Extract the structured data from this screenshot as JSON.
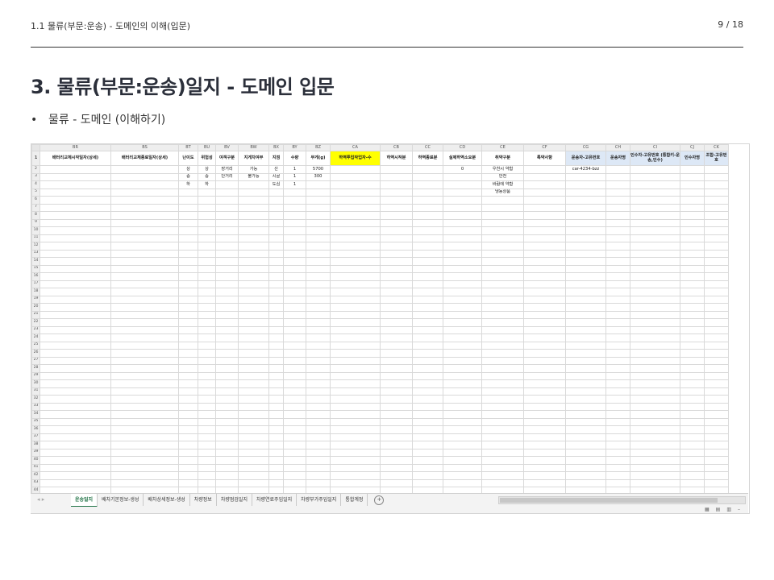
{
  "header": {
    "breadcrumb": "1.1 물류(부문:운송) - 도메인의 이해(입문)",
    "page_num": "9 / 18"
  },
  "title": "3. 물류(부문:운송)일지 - 도메인 입문",
  "bullet": "물류 - 도메인 (이해하기)",
  "sheet": {
    "columns": [
      "BR",
      "BS",
      "BT",
      "BU",
      "BV",
      "BW",
      "BX",
      "BY",
      "BZ",
      "CA",
      "CB",
      "CC",
      "CD",
      "CE",
      "CF",
      "CG",
      "CH",
      "CI",
      "CJ",
      "CK"
    ],
    "fields": [
      "배터리교체시작일자(상세)",
      "배터리교체종료일자(상세)",
      "난이도",
      "위험성",
      "여객구분",
      "지게차여부",
      "지점",
      "수량",
      "무게(g)",
      "하역투입작업자-수",
      "하역시작분",
      "하역종료분",
      "실제하역소요분",
      "취약구분",
      "특약사항",
      "운송자-고유번호",
      "운송자명",
      "인수자-고유번호 (통합키-운송,인수)",
      "인수자명",
      "조합-고유번호"
    ],
    "rows": [
      [
        "",
        "",
        "상",
        "상",
        "장거리",
        "가능",
        "산",
        "1",
        "5700",
        "",
        "",
        "",
        "0",
        "우천시 약함",
        "",
        "car-4234-bzz",
        "",
        "",
        "",
        ""
      ],
      [
        "",
        "",
        "중",
        "중",
        "단거리",
        "불가능",
        "시골",
        "1",
        "300",
        "",
        "",
        "",
        "",
        "안전",
        "",
        "",
        "",
        "",
        "",
        ""
      ],
      [
        "",
        "",
        "하",
        "하",
        "",
        "",
        "도심",
        "1",
        "",
        "",
        "",
        "",
        "",
        "바람에 약함",
        "",
        "",
        "",
        "",
        "",
        ""
      ],
      [
        "",
        "",
        "",
        "",
        "",
        "",
        "",
        "",
        "",
        "",
        "",
        "",
        "",
        "냉동상품",
        "",
        "",
        "",
        "",
        "",
        ""
      ]
    ],
    "total_rows": 44,
    "tabs": [
      "운송일지",
      "배차기본정보-생성",
      "배차상세정보-생성",
      "차량정보",
      "차량점검일지",
      "차량연료주입일지",
      "차량부가주입일지",
      "통합계정"
    ],
    "active_tab": "운송일지",
    "highlight_yellow": "CA",
    "highlight_blue": [
      "CG",
      "CH",
      "CI",
      "CJ",
      "CK"
    ]
  }
}
